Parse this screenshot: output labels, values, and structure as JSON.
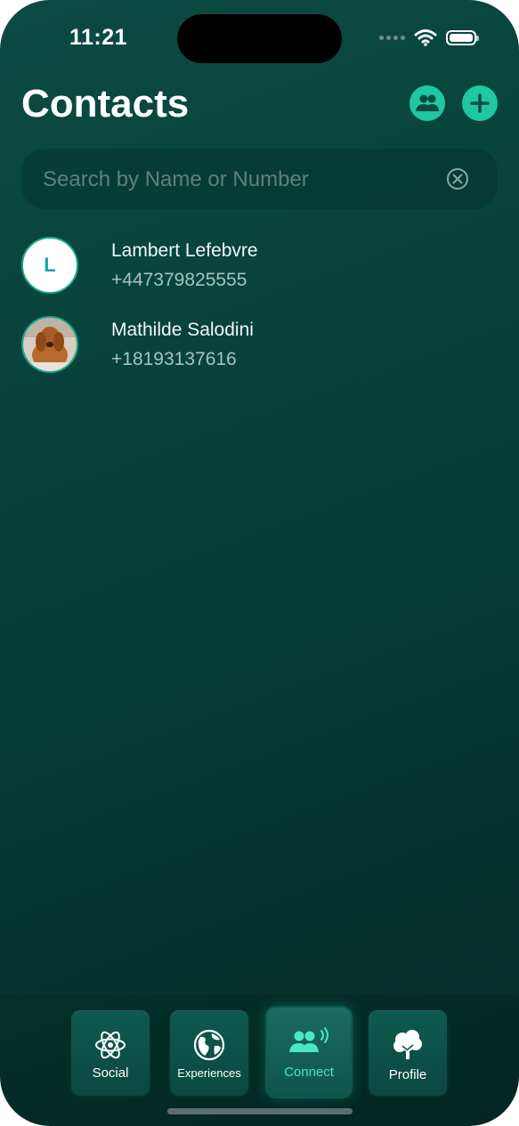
{
  "status": {
    "time": "11:21"
  },
  "header": {
    "title": "Contacts"
  },
  "search": {
    "placeholder": "Search by Name or Number",
    "value": ""
  },
  "contacts": [
    {
      "initial": "L",
      "name": "Lambert Lefebvre",
      "phone": "+447379825555"
    },
    {
      "initial": "",
      "name": "Mathilde Salodini",
      "phone": "+18193137616"
    }
  ],
  "tabs": [
    {
      "label": "Social",
      "icon": "atom-icon"
    },
    {
      "label": "Experiences",
      "icon": "globe-icon"
    },
    {
      "label": "Connect",
      "icon": "people-waves-icon",
      "active": true
    },
    {
      "label": "Profile",
      "icon": "tree-icon"
    }
  ],
  "colors": {
    "accent": "#1fc7a3",
    "active_tab_label": "#49e6c8",
    "background": "#064038"
  }
}
